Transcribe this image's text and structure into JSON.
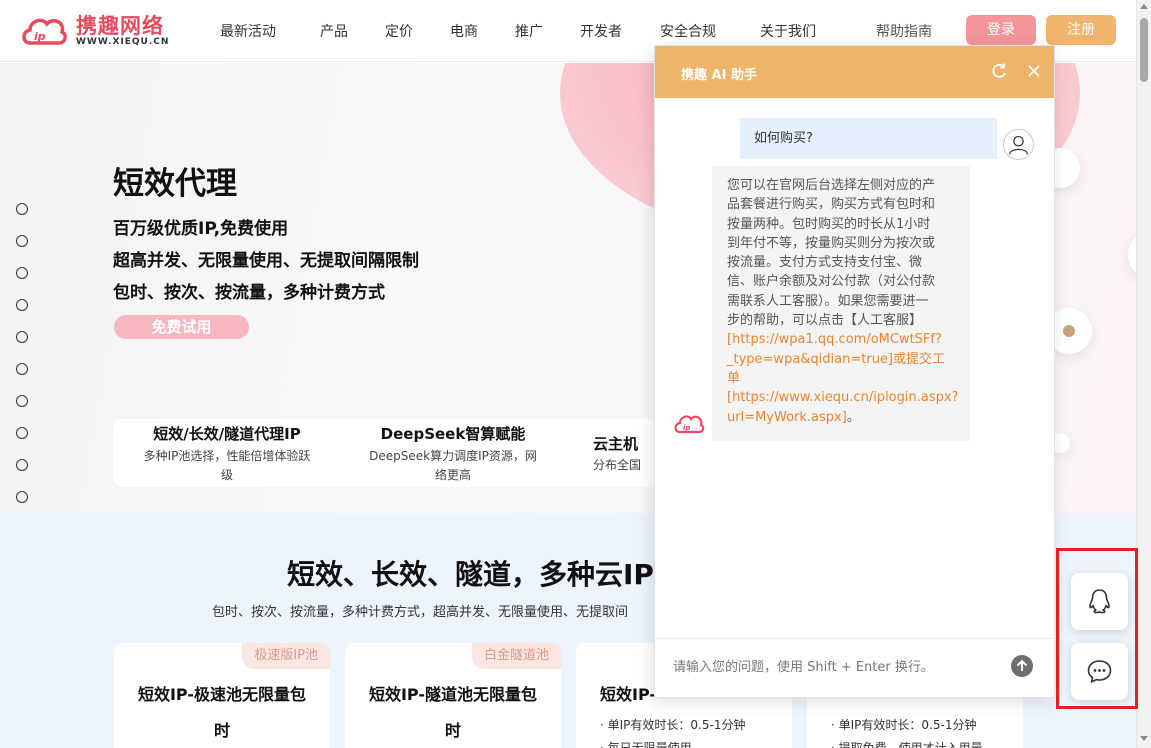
{
  "nav": {
    "logo_cn": "携趣网络",
    "logo_en": "WWW.XIEQU.CN",
    "items": [
      "最新活动",
      "产品",
      "定价",
      "电商",
      "推广",
      "开发者",
      "安全合规",
      "关于我们",
      "帮助指南"
    ],
    "login": "登录",
    "register": "注册"
  },
  "hero": {
    "title": "短效代理",
    "lines": [
      "百万级优质IP,免费使用",
      "超高并发、无限量使用、无提取间隔限制",
      "包时、按次、按流量，多种计费方式"
    ],
    "cta": "免费试用",
    "features": [
      {
        "title": "短效/长效/隧道代理IP",
        "desc_1": "多种IP池选择，性能倍增体验跃",
        "desc_2": "级"
      },
      {
        "title": "DeepSeek智算赋能",
        "desc_1": "DeepSeek算力调度IP资源，网",
        "desc_2": "络更高"
      },
      {
        "title": "云主机",
        "desc_1": "分布全国",
        "desc_2": ""
      }
    ]
  },
  "section": {
    "title": "短效、长效、隧道，多种云IP",
    "subtitle": "包时、按次、按流量，多种计费方式，超高并发、无限量使用、无提取间",
    "cards": [
      {
        "tag": "极速版IP池",
        "title": "短效IP-极速池无限量包时",
        "spec_1": "",
        "spec_2": ""
      },
      {
        "tag": "白金隧道池",
        "title": "短效IP-隧道池无限量包时",
        "spec_1": "",
        "spec_2": ""
      },
      {
        "tag": "",
        "title": "短效IP-",
        "spec_1": "· 单IP有效时长：0.5-1分钟",
        "spec_2": "· 每日无限量使用"
      },
      {
        "tag": "",
        "title": "",
        "spec_1": "· 单IP有效时长：0.5-1分钟",
        "spec_2": "· 提取免费，使用才计入用量"
      }
    ]
  },
  "chat": {
    "title": "携趣 AI 助手",
    "user_message": "如何购买?",
    "bot_lines": [
      "您可以在官网后台选择左侧对应的产",
      "品套餐进行购买，购买方式有包时和",
      "按量两种。包时购买的时长从1小时",
      "到年付不等，按量购买则分为按次或",
      "按流量。支付方式支持支付宝、微",
      "信、账户余额及对公付款（对公付款",
      "需联系人工客服）。如果您需要进一",
      "步的帮助，可以点击【人工客服】"
    ],
    "bot_link_lines": [
      "[https://wpa1.qq.com/oMCwtSFf?",
      "_type=wpa&qidian=true]或提交工",
      "单",
      "[https://www.xiequ.cn/iplogin.aspx?",
      "url=MyWork.aspx]"
    ],
    "bot_end": "。",
    "input_placeholder": "请输入您的问题，使用 Shift + Enter 换行。"
  },
  "float": {
    "icons": [
      "qq-icon",
      "chat-bubble-icon"
    ]
  },
  "colors": {
    "brand_red": "#e84a5f",
    "login_bg": "#f4959b",
    "register_bg": "#f0b46c",
    "chat_header": "#eeb46a",
    "link_orange": "#e8842f",
    "highlight_frame": "#e62020"
  }
}
